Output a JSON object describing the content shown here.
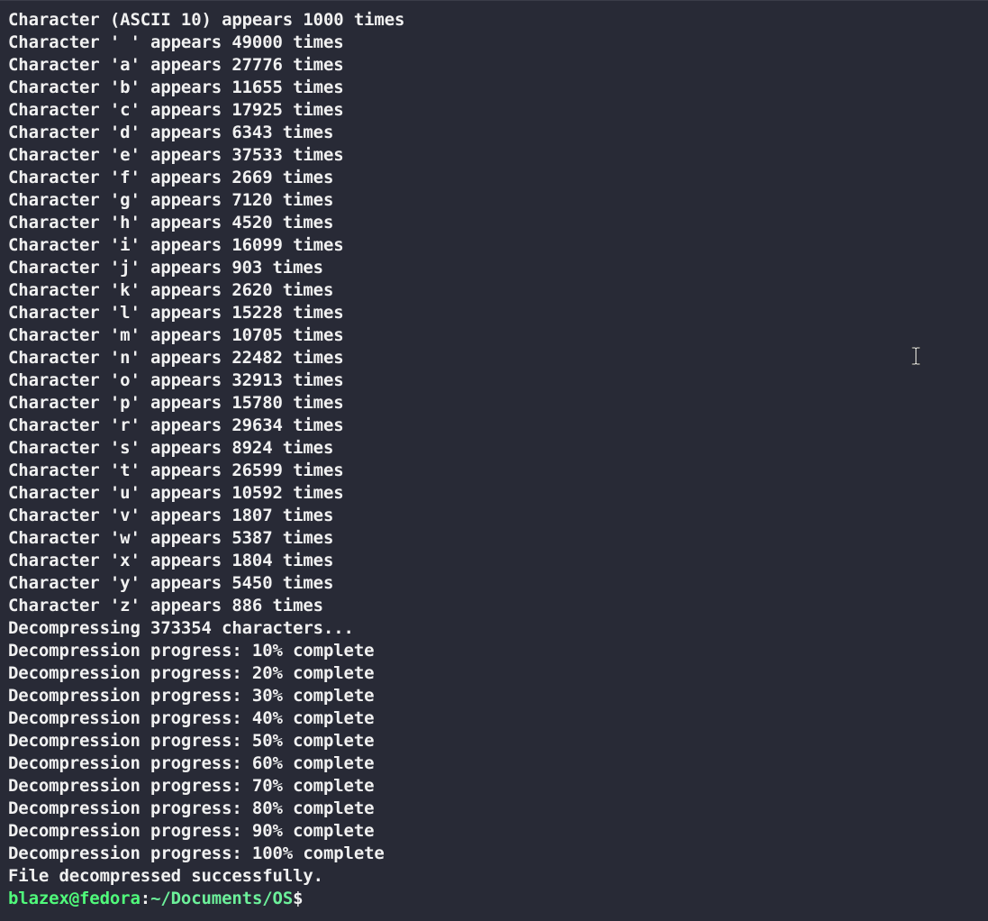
{
  "terminal": {
    "lines": [
      "Character (ASCII 10) appears 1000 times",
      "Character ' ' appears 49000 times",
      "Character 'a' appears 27776 times",
      "Character 'b' appears 11655 times",
      "Character 'c' appears 17925 times",
      "Character 'd' appears 6343 times",
      "Character 'e' appears 37533 times",
      "Character 'f' appears 2669 times",
      "Character 'g' appears 7120 times",
      "Character 'h' appears 4520 times",
      "Character 'i' appears 16099 times",
      "Character 'j' appears 903 times",
      "Character 'k' appears 2620 times",
      "Character 'l' appears 15228 times",
      "Character 'm' appears 10705 times",
      "Character 'n' appears 22482 times",
      "Character 'o' appears 32913 times",
      "Character 'p' appears 15780 times",
      "Character 'r' appears 29634 times",
      "Character 's' appears 8924 times",
      "Character 't' appears 26599 times",
      "Character 'u' appears 10592 times",
      "Character 'v' appears 1807 times",
      "Character 'w' appears 5387 times",
      "Character 'x' appears 1804 times",
      "Character 'y' appears 5450 times",
      "Character 'z' appears 886 times",
      "Decompressing 373354 characters...",
      "Decompression progress: 10% complete",
      "Decompression progress: 20% complete",
      "Decompression progress: 30% complete",
      "Decompression progress: 40% complete",
      "Decompression progress: 50% complete",
      "Decompression progress: 60% complete",
      "Decompression progress: 70% complete",
      "Decompression progress: 80% complete",
      "Decompression progress: 90% complete",
      "Decompression progress: 100% complete",
      "File decompressed successfully."
    ],
    "prompt": {
      "user_host": "blazex@fedora",
      "separator": ":",
      "path": "~/Documents/OS",
      "symbol": "$"
    },
    "colors": {
      "background": "#282a36",
      "foreground": "#f1f1f1",
      "prompt_user": "#50fa7b",
      "prompt_path": "#6cf09a"
    },
    "mouse_cursor_icon": "ibeam-cursor-icon"
  }
}
